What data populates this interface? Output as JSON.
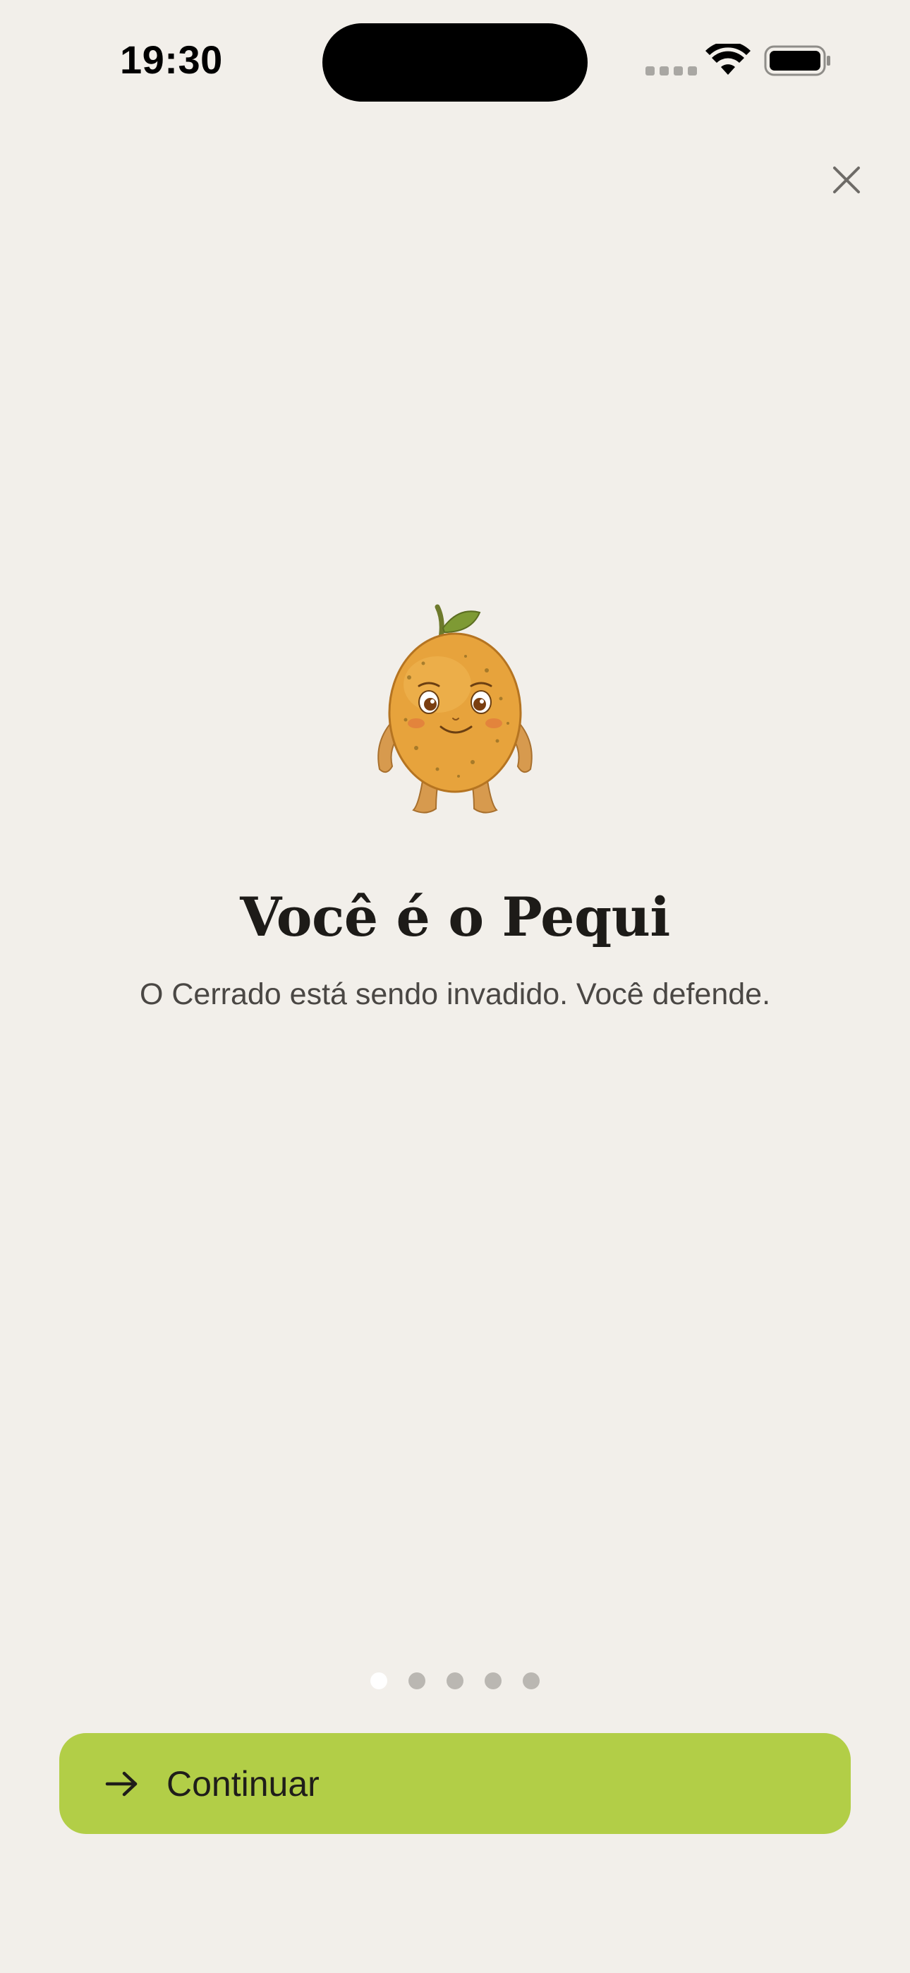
{
  "status_bar": {
    "time": "19:30"
  },
  "header": {
    "close_icon": "close-icon"
  },
  "onboarding": {
    "title": "Você é o Pequi",
    "subtitle": "O Cerrado está sendo invadido. Você defende.",
    "mascot_icon": "pequi-mascot",
    "page_count": 5,
    "current_page": 1
  },
  "cta": {
    "label": "Continuar",
    "icon": "arrow-right-icon"
  },
  "colors": {
    "background": "#F2EFEA",
    "accent": "#B2CE47",
    "dot_active": "#FFFFFF",
    "dot_inactive": "#BAB7B2"
  }
}
